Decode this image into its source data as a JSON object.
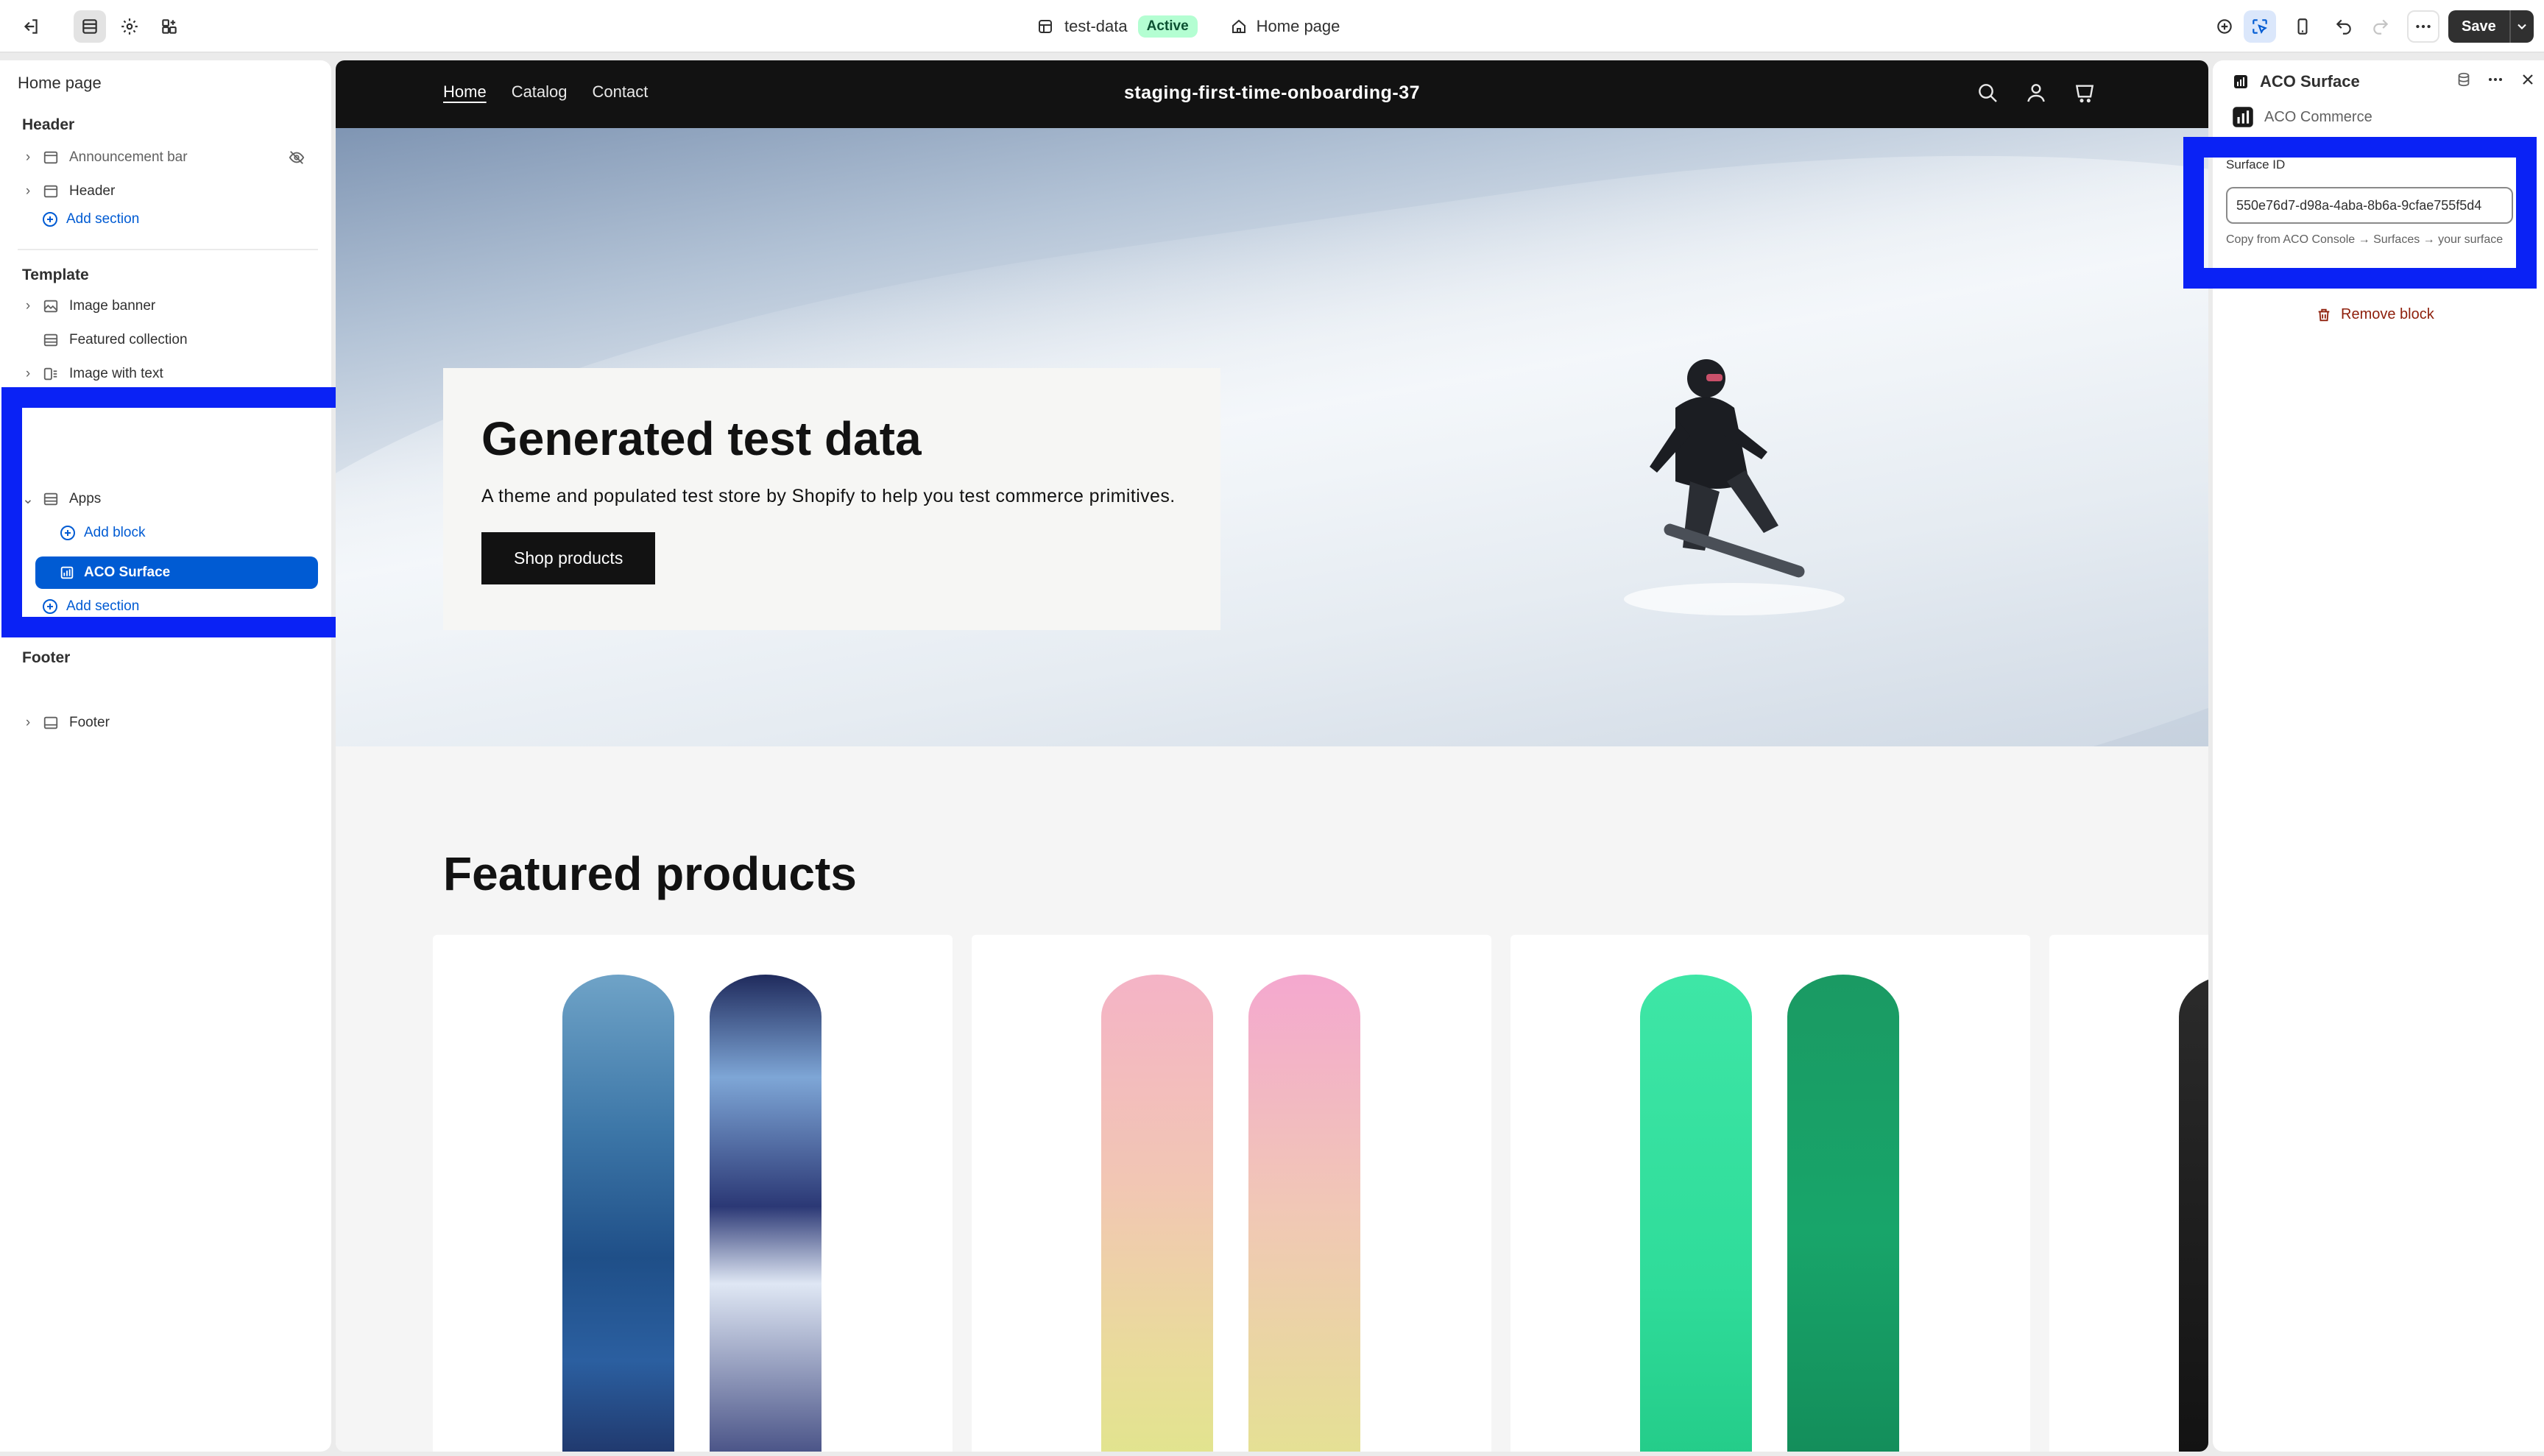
{
  "topbar": {
    "theme_name": "test-data",
    "theme_status": "Active",
    "page_selector": "Home page",
    "save_label": "Save"
  },
  "sidebar": {
    "title": "Home page",
    "header_group": {
      "label": "Header",
      "items": [
        {
          "label": "Announcement bar"
        },
        {
          "label": "Header"
        }
      ],
      "add_section": "Add section"
    },
    "template_group": {
      "label": "Template",
      "items": [
        {
          "label": "Image banner"
        },
        {
          "label": "Featured collection"
        },
        {
          "label": "Image with text"
        },
        {
          "label": "Apps"
        }
      ],
      "add_block": "Add block",
      "selected_block": "ACO Surface",
      "add_section": "Add section"
    },
    "footer_group": {
      "label": "Footer",
      "items": [
        {
          "label": "Footer"
        }
      ]
    }
  },
  "store": {
    "nav": [
      "Home",
      "Catalog",
      "Contact"
    ],
    "name": "staging-first-time-onboarding-37",
    "hero": {
      "title": "Generated test data",
      "subtitle": "A theme and populated test store by Shopify to help you test commerce primitives.",
      "button": "Shop products"
    },
    "featured_title": "Featured products"
  },
  "right_panel": {
    "title": "ACO Surface",
    "app_name": "ACO Commerce",
    "field_label": "Surface ID",
    "field_value": "550e76d7-d98a-4aba-8b6a-9cfae755f5d4",
    "help_text": "Copy from ACO Console → Surfaces → your surface",
    "remove_label": "Remove block"
  },
  "colors": {
    "accent_blue": "#005bd3",
    "highlight_blue": "#0a22f5",
    "status_green_bg": "#b4fed2",
    "danger": "#8e1f0b"
  }
}
